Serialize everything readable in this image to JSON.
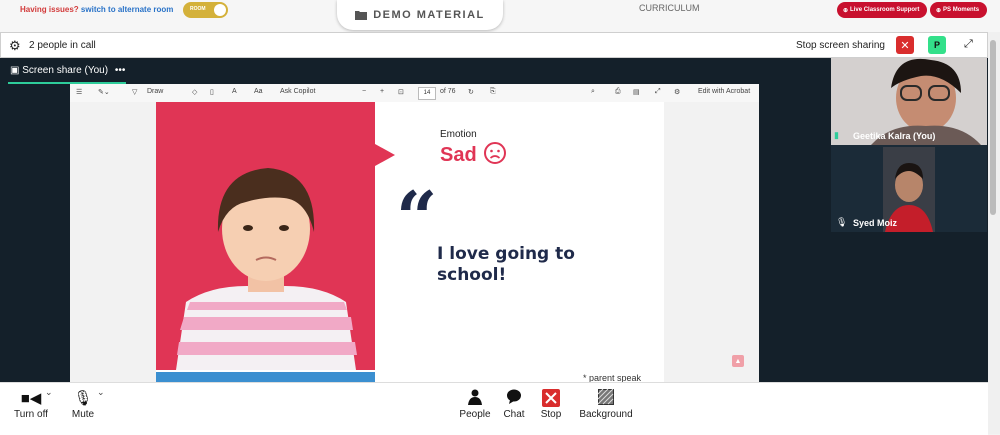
{
  "topbar": {
    "issue_text": "Having issues?",
    "switch_link": "switch to alternate room",
    "toggle_label": "ROOM",
    "demo_material": "DEMO MATERIAL",
    "curriculum": "CURRICULUM",
    "live_support": "Live Classroom Support",
    "ps_moments": "PS Moments"
  },
  "callbar": {
    "people_count": "2 people in call",
    "stop_sharing": "Stop screen sharing",
    "participant_initial": "P"
  },
  "screenshare": {
    "label": "Screen share (You)",
    "more": "•••"
  },
  "pdf": {
    "draw": "Draw",
    "ask_copilot": "Ask Copilot",
    "page": "14",
    "of_pages": "of 76",
    "edit_acrobat": "Edit with Acrobat"
  },
  "slide": {
    "emotion_label": "Emotion",
    "emotion": "Sad",
    "quote_mark": "“",
    "message": "I love going to school!",
    "footnote": "* parent speak"
  },
  "participants": [
    {
      "name": "Geetika Kalra (You)"
    },
    {
      "name": "Syed Moiz"
    }
  ],
  "controls": {
    "turn_off": "Turn off",
    "mute": "Mute",
    "people": "People",
    "chat": "Chat",
    "stop": "Stop",
    "background": "Background"
  },
  "colors": {
    "brand_red": "#c8102e",
    "slide_red": "#e03555",
    "navy": "#1f2a4a",
    "stage": "#14202a",
    "green": "#2ecc9a"
  }
}
